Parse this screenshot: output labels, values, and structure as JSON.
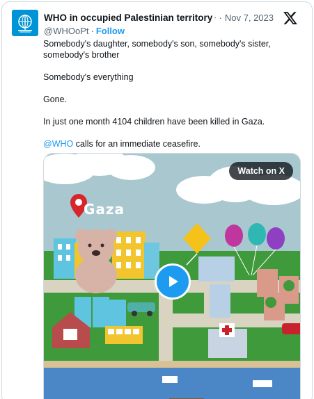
{
  "post": {
    "display_name": "WHO in occupied Palestinian territory",
    "handle": "@WHOoPt",
    "separator": "·",
    "follow_label": "Follow",
    "date": "Nov 7, 2023"
  },
  "body": {
    "line1": "Somebody's daughter, somebody's son, somebody's sister, somebody's brother",
    "line2": "Somebody's everything",
    "line3": "Gone.",
    "line4": "In just one month 4104 children have been killed in Gaza.",
    "mention": "@WHO",
    "line5_rest": " calls for an immediate ceasefire."
  },
  "media": {
    "watch_label": "Watch on X",
    "map_label": "Gaza",
    "play_icon": "play-icon"
  },
  "colors": {
    "accent": "#1d9bf0",
    "avatar_bg": "#0093d5",
    "sky": "#a8c7cf",
    "grass": "#3f9a3c"
  }
}
